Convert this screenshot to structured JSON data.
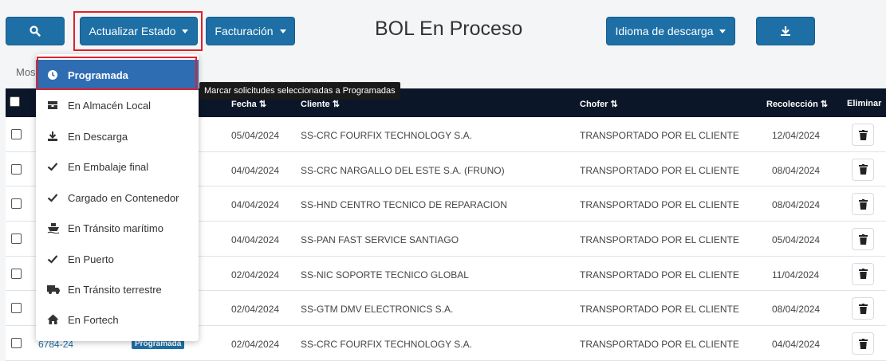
{
  "toolbar": {
    "update_status_label": "Actualizar Estado",
    "billing_label": "Facturación",
    "download_lang_label": "Idioma de descarga",
    "page_title": "BOL En Proceso"
  },
  "show_prefix": "Mos",
  "table": {
    "headers": {
      "fecha": "Fecha",
      "cliente": "Cliente",
      "chofer": "Chofer",
      "recoleccion": "Recolección",
      "eliminar": "Eliminar"
    },
    "rows": [
      {
        "fecha": "05/04/2024",
        "cliente": "SS-CRC FOURFIX TECHNOLOGY S.A.",
        "chofer": "TRANSPORTADO POR EL CLIENTE",
        "recoleccion": "12/04/2024"
      },
      {
        "fecha": "04/04/2024",
        "cliente": "SS-CRC NARGALLO DEL ESTE S.A. (FRUNO)",
        "chofer": "TRANSPORTADO POR EL CLIENTE",
        "recoleccion": "08/04/2024"
      },
      {
        "fecha": "04/04/2024",
        "cliente": "SS-HND CENTRO TECNICO DE REPARACION",
        "chofer": "TRANSPORTADO POR EL CLIENTE",
        "recoleccion": "08/04/2024"
      },
      {
        "fecha": "04/04/2024",
        "cliente": "SS-PAN FAST SERVICE SANTIAGO",
        "chofer": "TRANSPORTADO POR EL CLIENTE",
        "recoleccion": "05/04/2024"
      },
      {
        "fecha": "02/04/2024",
        "cliente": "SS-NIC SOPORTE TECNICO GLOBAL",
        "chofer": "TRANSPORTADO POR EL CLIENTE",
        "recoleccion": "11/04/2024"
      },
      {
        "fecha": "02/04/2024",
        "cliente": "SS-GTM DMV ELECTRONICS S.A.",
        "chofer": "TRANSPORTADO POR EL CLIENTE",
        "recoleccion": "08/04/2024"
      },
      {
        "fecha": "02/04/2024",
        "cliente": "SS-CRC FOURFIX TECHNOLOGY S.A.",
        "chofer": "TRANSPORTADO POR EL CLIENTE",
        "recoleccion": "04/04/2024",
        "bol": "6784-24",
        "badge": "Programada"
      }
    ]
  },
  "menu": {
    "items": [
      {
        "label": "Programada",
        "icon": "clock-icon"
      },
      {
        "label": "En Almacén Local",
        "icon": "warehouse-icon"
      },
      {
        "label": "En Descarga",
        "icon": "download-icon"
      },
      {
        "label": "En Embalaje final",
        "icon": "check-icon"
      },
      {
        "label": "Cargado en Contenedor",
        "icon": "check-icon"
      },
      {
        "label": "En Tránsito marítimo",
        "icon": "ship-icon"
      },
      {
        "label": "En Puerto",
        "icon": "check-icon"
      },
      {
        "label": "En Tránsito terrestre",
        "icon": "truck-icon"
      },
      {
        "label": "En Fortech",
        "icon": "home-icon"
      }
    ]
  },
  "tooltip": "Marcar solicitudes seleccionadas a Programadas",
  "colors": {
    "primary": "#1d6fa5",
    "highlight": "#e0202a",
    "header": "#0b1628",
    "menu_active": "#2f6db3"
  }
}
